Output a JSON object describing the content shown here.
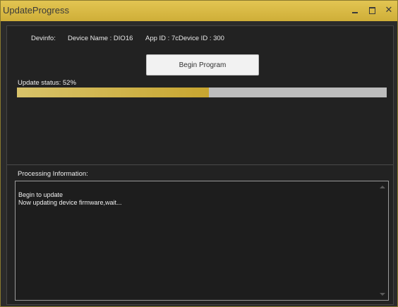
{
  "window": {
    "title": "UpdateProgress",
    "controls": {
      "minimize": "minimize-icon",
      "maximize": "maximize-icon",
      "close": "✕"
    }
  },
  "device_info": {
    "label": "Devinfo:",
    "device_name": "Device Name : DIO16",
    "app_id": "App ID : 7c",
    "device_id": "Device ID : 300"
  },
  "actions": {
    "begin_label": "Begin Program"
  },
  "update": {
    "status_label": "Update status:  52%",
    "progress": 0.52
  },
  "processing": {
    "label": "Processing Information:",
    "lines": [
      "Begin to update",
      "Now updating device firmware,wait..."
    ]
  },
  "colors": {
    "accent": "#cfae38",
    "background": "#222222",
    "track": "#bdbdbd"
  }
}
